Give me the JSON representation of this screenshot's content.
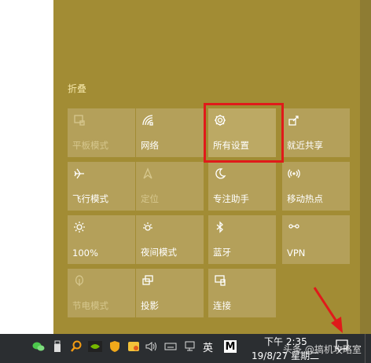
{
  "colors": {
    "panel": "#a28c34",
    "tile": "#b4a05a",
    "highlight": "#e01a1a",
    "taskbar": "#2b2e31"
  },
  "action_center": {
    "collapse_label": "折叠",
    "tiles": [
      {
        "label": "平板模式",
        "icon": "tablet-mode-icon",
        "disabled": true
      },
      {
        "label": "网络",
        "icon": "network-icon",
        "disabled": false
      },
      {
        "label": "所有设置",
        "icon": "gear-icon",
        "disabled": false
      },
      {
        "label": "就近共享",
        "icon": "nearby-share-icon",
        "disabled": false
      },
      {
        "label": "飞行模式",
        "icon": "airplane-icon",
        "disabled": false
      },
      {
        "label": "定位",
        "icon": "location-icon",
        "disabled": true
      },
      {
        "label": "专注助手",
        "icon": "moon-icon",
        "disabled": false
      },
      {
        "label": "移动热点",
        "icon": "hotspot-icon",
        "disabled": false
      },
      {
        "label": "100%",
        "icon": "brightness-icon",
        "disabled": false
      },
      {
        "label": "夜间模式",
        "icon": "night-light-icon",
        "disabled": false
      },
      {
        "label": "蓝牙",
        "icon": "bluetooth-icon",
        "disabled": false
      },
      {
        "label": "VPN",
        "icon": "vpn-icon",
        "disabled": false
      },
      {
        "label": "节电模式",
        "icon": "battery-saver-icon",
        "disabled": true
      },
      {
        "label": "投影",
        "icon": "project-icon",
        "disabled": false
      },
      {
        "label": "连接",
        "icon": "connect-icon",
        "disabled": false
      }
    ]
  },
  "taskbar": {
    "ime": "英",
    "clock_time": "下午 2:35",
    "clock_date": "19/8/27 星期二",
    "watermark": "头条 @搞机攻略室",
    "m_label": "M"
  }
}
